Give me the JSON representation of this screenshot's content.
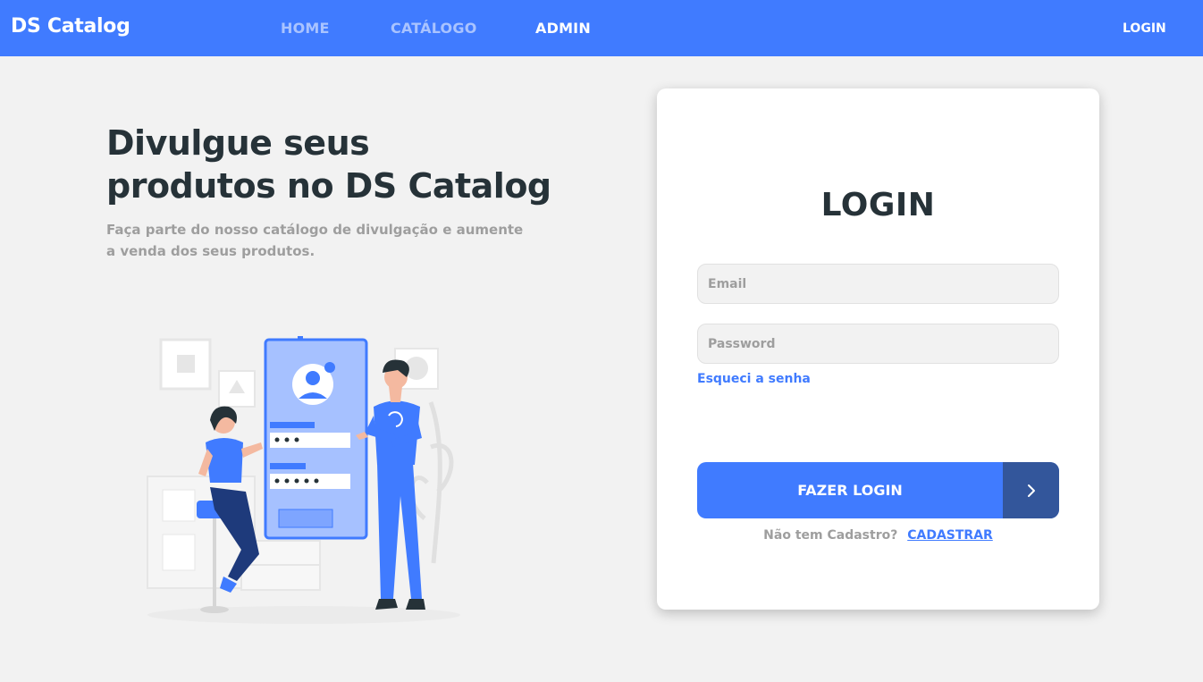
{
  "navbar": {
    "brand": "DS Catalog",
    "links": [
      {
        "label": "HOME",
        "active": false
      },
      {
        "label": "CATÁLOGO",
        "active": false
      },
      {
        "label": "ADMIN",
        "active": true
      }
    ],
    "login_label": "LOGIN"
  },
  "hero": {
    "title_line1": "Divulgue seus",
    "title_line2": "produtos no DS Catalog",
    "subtitle": "Faça parte do nosso catálogo de divulgação e aumente a venda dos seus produtos.",
    "illustration_icon": "people-login-illustration"
  },
  "login_card": {
    "title": "LOGIN",
    "email_placeholder": "Email",
    "email_value": "",
    "password_placeholder": "Password",
    "password_value": "",
    "forgot_label": "Esqueci a senha",
    "submit_label": "FAZER LOGIN",
    "submit_icon": "chevron-right-icon",
    "signup_text": "Não tem Cadastro?",
    "signup_link": "CADASTRAR"
  },
  "colors": {
    "primary": "#407bff",
    "primary_dark": "#33569b",
    "text_dark": "#263238",
    "text_muted": "#9e9e9e",
    "background": "#f2f2f2"
  }
}
